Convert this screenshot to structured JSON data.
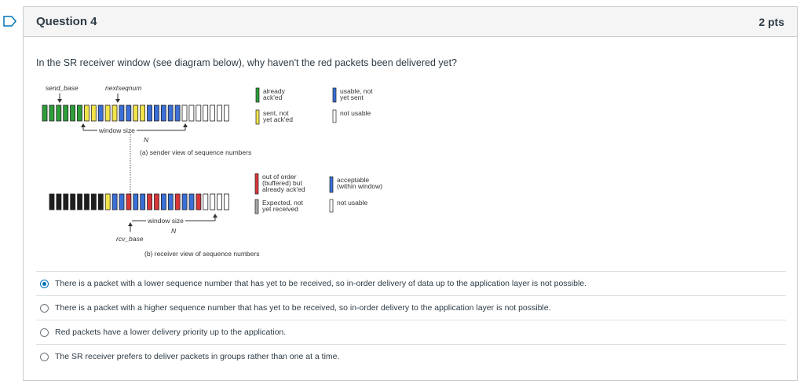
{
  "question": {
    "title": "Question 4",
    "points": "2 pts",
    "prompt": "In the SR receiver window (see diagram below), why haven't the red packets been delivered yet?"
  },
  "diagram": {
    "sender": {
      "send_base_label": "send_base",
      "nextseqnum_label": "nextseqnum",
      "window_size_label": "window size",
      "n_label": "N",
      "caption": "(a) sender view of sequence numbers",
      "legend": [
        {
          "text": [
            "already",
            "ack'ed"
          ],
          "color": "#2e9e3a"
        },
        {
          "text": [
            "sent, not",
            "yet ack'ed"
          ],
          "color": "#f2e34a"
        },
        {
          "text": [
            "usable, not",
            "yet sent"
          ],
          "color": "#3a6fd8"
        },
        {
          "text": [
            "not usable"
          ],
          "color": "#ffffff"
        }
      ],
      "packets": [
        "g",
        "g",
        "g",
        "g",
        "g",
        "g",
        "y",
        "y",
        "b",
        "y",
        "y",
        "b",
        "b",
        "y",
        "y",
        "b",
        "b",
        "b",
        "b",
        "b",
        "w",
        "w",
        "w",
        "w",
        "w",
        "w",
        "w"
      ]
    },
    "receiver": {
      "rcv_base_label": "rcv_base",
      "window_size_label": "window size",
      "n_label": "N",
      "caption": "(b) receiver view of sequence numbers",
      "legend": [
        {
          "text": [
            "out of order",
            "(buffered) but",
            "already ack'ed"
          ],
          "color": "#d8363a"
        },
        {
          "text": [
            "Expected, not",
            "yet received"
          ],
          "color": "#a8a8a8"
        },
        {
          "text": [
            "acceptable",
            "(within window)"
          ],
          "color": "#3a6fd8"
        },
        {
          "text": [
            "not usable"
          ],
          "color": "#ffffff"
        }
      ],
      "packets": [
        "k",
        "k",
        "k",
        "k",
        "k",
        "k",
        "k",
        "k",
        "y",
        "b",
        "b",
        "r",
        "b",
        "b",
        "r",
        "r",
        "b",
        "b",
        "r",
        "b",
        "b",
        "r",
        "w",
        "w",
        "w",
        "w"
      ]
    },
    "colors": {
      "g": "#2e9e3a",
      "y": "#f2e34a",
      "b": "#3a6fd8",
      "w": "#ffffff",
      "r": "#d8363a",
      "k": "#1e1e1e"
    }
  },
  "answers": [
    {
      "text": "There is a packet with a lower sequence number that has yet to be received, so in-order delivery of data up to the application layer is not possible.",
      "selected": true
    },
    {
      "text": "There is a packet with a higher sequence number that has yet to be received, so in-order delivery to the application layer is not possible.",
      "selected": false
    },
    {
      "text": "Red packets have a lower delivery priority up to the application.",
      "selected": false
    },
    {
      "text": "The SR receiver prefers to deliver packets in groups rather than one at a time.",
      "selected": false
    }
  ]
}
